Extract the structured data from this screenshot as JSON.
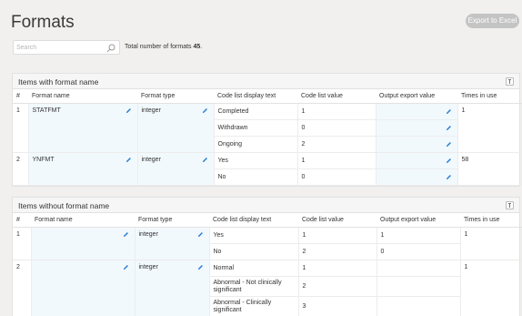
{
  "page": {
    "title": "Formats",
    "export_label": "Export to Excel",
    "search_placeholder": "Search",
    "total_prefix": "Total number of formats",
    "total_count": "45",
    "total_suffix": "."
  },
  "columns": [
    "#",
    "Format name",
    "Format type",
    "Code list display text",
    "Code list value",
    "Output export value",
    "Times in use"
  ],
  "with_name": {
    "title": "Items with format name",
    "rows": [
      {
        "num": "1",
        "name": "STATFMT",
        "type": "integer",
        "times": "1",
        "items": [
          {
            "text": "Completed",
            "value": "1",
            "export": ""
          },
          {
            "text": "Withdrawn",
            "value": "0",
            "export": ""
          },
          {
            "text": "Ongoing",
            "value": "2",
            "export": ""
          }
        ]
      },
      {
        "num": "2",
        "name": "YNFMT",
        "type": "integer",
        "times": "58",
        "items": [
          {
            "text": "Yes",
            "value": "1",
            "export": ""
          },
          {
            "text": "No",
            "value": "0",
            "export": ""
          }
        ]
      }
    ]
  },
  "without_name": {
    "title": "Items without format name",
    "rows": [
      {
        "num": "1",
        "name": "",
        "type": "integer",
        "times": "1",
        "items": [
          {
            "text": "Yes",
            "value": "1",
            "export": "1"
          },
          {
            "text": "No",
            "value": "2",
            "export": "0"
          }
        ]
      },
      {
        "num": "2",
        "name": "",
        "type": "integer",
        "times": "1",
        "items": [
          {
            "text": "Normal",
            "value": "1",
            "export": ""
          },
          {
            "text": "Abnormal - Not clinically significant",
            "value": "2",
            "export": ""
          },
          {
            "text": "Abnormal - Clinically significant",
            "value": "3",
            "export": ""
          }
        ]
      }
    ]
  },
  "colors": {
    "accent": "#2b7fd4",
    "edit_bg": "#f2f9fd",
    "button_bg": "#c4c4c4"
  },
  "icons": {
    "search": "search-icon",
    "edit": "pencil-icon",
    "collapse": "collapse-icon"
  }
}
